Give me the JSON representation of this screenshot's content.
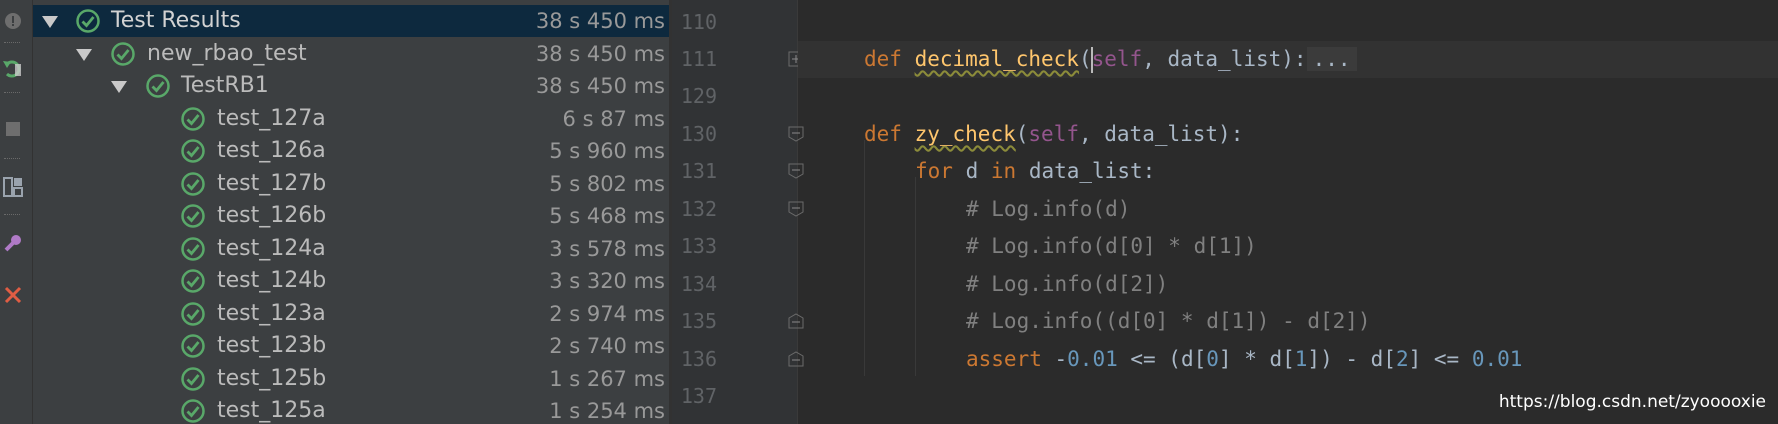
{
  "test_results": {
    "root": {
      "label": "Test Results",
      "time": "38 s 450 ms"
    },
    "suite": {
      "label": "new_rbao_test",
      "time": "38 s 450 ms"
    },
    "class": {
      "label": "TestRB1",
      "time": "38 s 450 ms"
    },
    "tests": [
      {
        "label": "test_127a",
        "time": "6 s 87 ms"
      },
      {
        "label": "test_126a",
        "time": "5 s 960 ms"
      },
      {
        "label": "test_127b",
        "time": "5 s 802 ms"
      },
      {
        "label": "test_126b",
        "time": "5 s 468 ms"
      },
      {
        "label": "test_124a",
        "time": "3 s 578 ms"
      },
      {
        "label": "test_124b",
        "time": "3 s 320 ms"
      },
      {
        "label": "test_123a",
        "time": "2 s 974 ms"
      },
      {
        "label": "test_123b",
        "time": "2 s 740 ms"
      },
      {
        "label": "test_125b",
        "time": "1 s 267 ms"
      },
      {
        "label": "test_125a",
        "time": "1 s 254 ms"
      }
    ]
  },
  "editor": {
    "line_numbers": [
      "110",
      "111",
      "129",
      "130",
      "131",
      "132",
      "133",
      "134",
      "135",
      "136",
      "137"
    ],
    "lines": {
      "l111_kw": "def",
      "l111_fn": "decimal_check",
      "l111_self": "self",
      "l111_rest": ", data_list):",
      "l111_folded": "...",
      "l130_kw": "def",
      "l130_fn": "zy_check",
      "l130_open": "(",
      "l130_self": "self",
      "l130_rest": ", data_list):",
      "l131_kw1": "for",
      "l131_var": " d ",
      "l131_kw2": "in",
      "l131_rest": " data_list:",
      "l132": "# Log.info(d)",
      "l133": "# Log.info(d[0] * d[1])",
      "l134": "# Log.info(d[2])",
      "l135": "# Log.info((d[0] * d[1]) - d[2])",
      "l136_kw": "assert",
      "l136_a": " -",
      "l136_n1": "0.01",
      "l136_b": " <= (d[",
      "l136_n2": "0",
      "l136_c": "] * d[",
      "l136_n3": "1",
      "l136_d": "]) - d[",
      "l136_n4": "2",
      "l136_e": "] <= ",
      "l136_n5": "0.01"
    }
  },
  "watermark": "https://blog.csdn.net/zyooooxie",
  "colors": {
    "pass_green": "#59a869",
    "keyword": "#cc7832",
    "function": "#ffc66d",
    "self": "#94558d",
    "comment": "#808080",
    "number": "#6897bb"
  },
  "icons": [
    "stop-icon",
    "rerun-icon",
    "settings-icon",
    "layout-icon",
    "pin-icon",
    "close-icon",
    "pass-check-icon",
    "expand-arrow-icon",
    "fold-icon"
  ]
}
